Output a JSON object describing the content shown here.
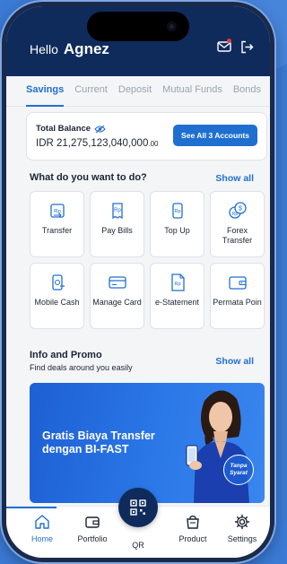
{
  "header": {
    "greeting": "Hello",
    "user_name": "Agnez",
    "icons": [
      "mail-icon",
      "logout-icon"
    ]
  },
  "tabs": [
    {
      "label": "Savings",
      "active": true
    },
    {
      "label": "Current",
      "active": false
    },
    {
      "label": "Deposit",
      "active": false
    },
    {
      "label": "Mutual Funds",
      "active": false
    },
    {
      "label": "Bonds",
      "active": false
    }
  ],
  "balance": {
    "label": "Total Balance",
    "currency": "IDR",
    "amount": "21,275,123,040,000",
    "cents": ".00",
    "button_label": "See All 3 Accounts"
  },
  "actions": {
    "title": "What do you want to do?",
    "link": "Show all",
    "items": [
      {
        "label": "Transfer",
        "icon": "transfer-icon"
      },
      {
        "label": "Pay Bills",
        "icon": "bill-icon"
      },
      {
        "label": "Top Up",
        "icon": "topup-icon"
      },
      {
        "label": "Forex Transfer",
        "icon": "forex-icon"
      },
      {
        "label": "Mobile Cash",
        "icon": "mobile-cash-icon"
      },
      {
        "label": "Manage Card",
        "icon": "card-icon"
      },
      {
        "label": "e-Statement",
        "icon": "statement-icon"
      },
      {
        "label": "Permata Poin",
        "icon": "wallet-icon"
      }
    ]
  },
  "promo": {
    "title": "Info and Promo",
    "subtitle": "Find deals around you easily",
    "link": "Show all",
    "banner_line1": "Gratis Biaya Transfer",
    "banner_line2": "dengan BI-FAST",
    "badge_line1": "Tanpa",
    "badge_line2": "Syarat"
  },
  "bottom_nav": [
    {
      "label": "Home",
      "icon": "home-icon",
      "active": true
    },
    {
      "label": "Portfolio",
      "icon": "portfolio-icon",
      "active": false
    },
    {
      "label": "QR",
      "icon": "qr-icon",
      "active": false
    },
    {
      "label": "Product",
      "icon": "product-icon",
      "active": false
    },
    {
      "label": "Settings",
      "icon": "gear-icon",
      "active": false
    }
  ],
  "colors": {
    "primary": "#1f6fd1",
    "header": "#0f2b5b",
    "background": "#3b7bd6"
  }
}
